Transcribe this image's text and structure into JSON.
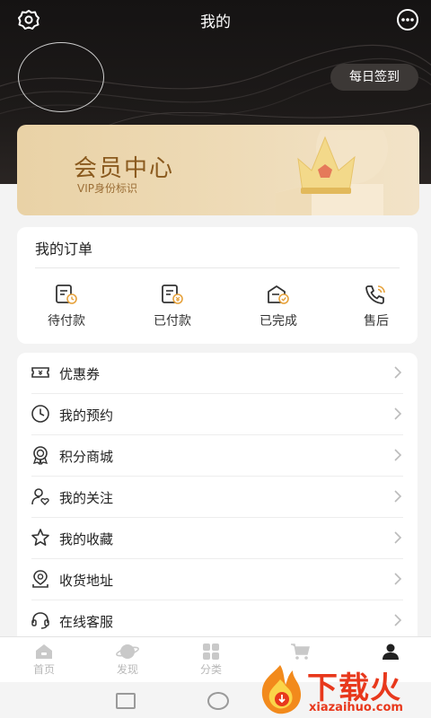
{
  "header": {
    "title": "我的",
    "settings_icon": "gear-icon",
    "more_icon": "more-dots-icon",
    "checkin_label": "每日签到"
  },
  "vip": {
    "title": "会员中心",
    "subtitle": "VIP身份标识",
    "crown_icon": "crown-icon"
  },
  "orders": {
    "title": "我的订单",
    "items": [
      {
        "label": "待付款",
        "icon": "pending-payment-icon"
      },
      {
        "label": "已付款",
        "icon": "paid-icon"
      },
      {
        "label": "已完成",
        "icon": "completed-icon"
      },
      {
        "label": "售后",
        "icon": "after-sales-phone-icon"
      }
    ]
  },
  "menu": {
    "items": [
      {
        "label": "优惠券",
        "icon": "coupon-icon"
      },
      {
        "label": "我的预约",
        "icon": "clock-icon"
      },
      {
        "label": "积分商城",
        "icon": "award-badge-icon"
      },
      {
        "label": "我的关注",
        "icon": "user-heart-icon"
      },
      {
        "label": "我的收藏",
        "icon": "star-icon"
      },
      {
        "label": "收货地址",
        "icon": "location-icon"
      },
      {
        "label": "在线客服",
        "icon": "headset-icon"
      }
    ]
  },
  "tabbar": {
    "items": [
      {
        "label": "首页",
        "icon": "home-icon"
      },
      {
        "label": "发现",
        "icon": "planet-icon"
      },
      {
        "label": "分类",
        "icon": "grid-icon"
      },
      {
        "label": "",
        "icon": "cart-icon"
      },
      {
        "label": "",
        "icon": "user-icon"
      }
    ]
  },
  "watermark": {
    "text": "下载火",
    "url": "xiazaihuo.com"
  },
  "colors": {
    "header_bg": "#1a1716",
    "vip_gold": "#8a5a1e",
    "accent_orange": "#e6a23c",
    "watermark_red": "#e8381c"
  }
}
